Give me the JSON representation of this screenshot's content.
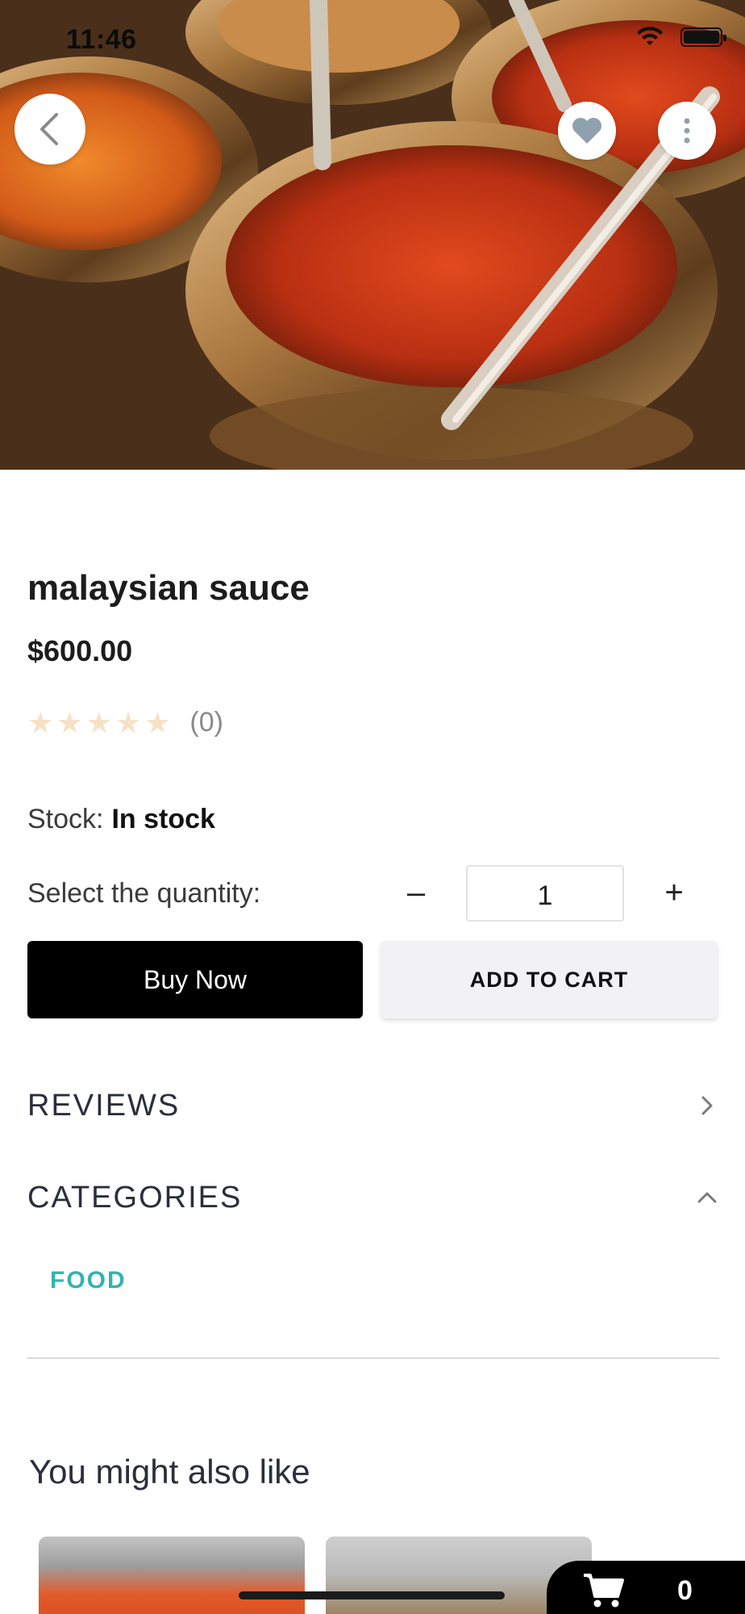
{
  "status_bar": {
    "time": "11:46"
  },
  "hero": {
    "image_description_icon": "product-image"
  },
  "product": {
    "title": "malaysian sauce",
    "price": "$600.00",
    "rating_stars": 0,
    "review_count": "(0)",
    "stock_label": "Stock:",
    "stock_value": "In stock",
    "quantity_label": "Select the quantity:",
    "quantity_value": "1",
    "minus_symbol": "–",
    "plus_symbol": "+"
  },
  "actions": {
    "buy_now": "Buy Now",
    "add_to_cart": "ADD TO CART"
  },
  "sections": {
    "reviews": "REVIEWS",
    "categories": "CATEGORIES",
    "category_items": [
      "FOOD"
    ]
  },
  "recommendations": {
    "heading": "You might also like"
  },
  "cart": {
    "count": "0"
  },
  "colors": {
    "accent": "#33b3b0",
    "primary_button": "#000000",
    "secondary_button": "#f2f2f4",
    "star_empty": "#f7e1c6"
  }
}
